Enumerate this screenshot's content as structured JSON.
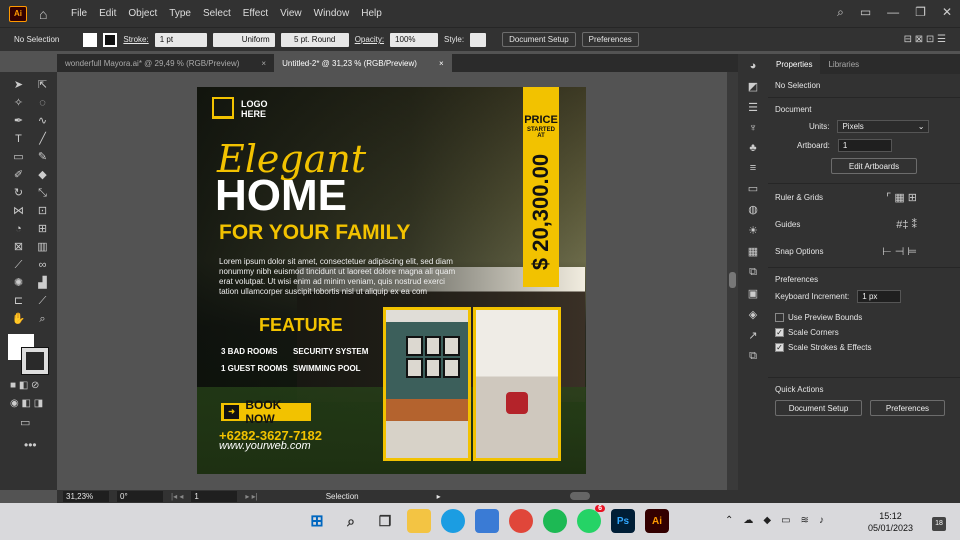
{
  "menubar": {
    "app_badge": "Ai",
    "items": [
      "File",
      "Edit",
      "Object",
      "Type",
      "Select",
      "Effect",
      "View",
      "Window",
      "Help"
    ]
  },
  "control_bar": {
    "selection": "No Selection",
    "stroke_label": "Stroke:",
    "stroke_value": "1 pt",
    "profile": "Uniform",
    "brush": "5 pt. Round",
    "opacity_label": "Opacity:",
    "opacity_value": "100%",
    "style_label": "Style:",
    "doc_setup": "Document Setup",
    "preferences": "Preferences"
  },
  "tabs": [
    {
      "label": "wonderfull Mayora.ai* @ 29,49 % (RGB/Preview)",
      "close": "×"
    },
    {
      "label": "Untitled-2* @ 31,23 % (RGB/Preview)",
      "close": "×"
    }
  ],
  "artboard": {
    "logo_text": "LOGO HERE",
    "elegant": "Elegant",
    "home": "HOME",
    "family": "FOR YOUR FAMILY",
    "lorem": "Lorem ipsum dolor sit amet, consectetuer adipiscing elit, sed diam nonummy nibh euismod tincidunt ut laoreet dolore magna ali quam erat volutpat. Ut wisi enim ad minim veniam, quis nostrud exerci tation ullamcorper suscipit lobortis nisl ut aliquip ex ea com",
    "feature_title": "FEATURE",
    "features": [
      "3 BAD ROOMS",
      "SECURITY SYSTEM",
      "1 GUEST ROOMS",
      "SWIMMING POOL"
    ],
    "book_now": "BOOK NOW",
    "phone": "+6282-3627-7182",
    "web": "www.yourweb.com",
    "price_title": "PRICE",
    "price_sub": "STARTED AT",
    "price_value": "$ 20,300.00",
    "accent": "#f2c200"
  },
  "properties": {
    "tab_properties": "Properties",
    "tab_libraries": "Libraries",
    "no_selection": "No Selection",
    "document": "Document",
    "units_label": "Units:",
    "units_value": "Pixels",
    "artboard_label": "Artboard:",
    "artboard_value": "1",
    "edit_artboards": "Edit Artboards",
    "rulers": "Ruler & Grids",
    "guides": "Guides",
    "snap": "Snap Options",
    "prefs_title": "Preferences",
    "keyboard_label": "Keyboard Increment:",
    "keyboard_value": "1 px",
    "use_preview": "Use Preview Bounds",
    "scale_corners": "Scale Corners",
    "scale_strokes": "Scale Strokes & Effects",
    "quick_actions": "Quick Actions",
    "doc_setup": "Document Setup",
    "preferences": "Preferences"
  },
  "status": {
    "zoom": "31,23%",
    "rotation": "0°",
    "artboard": "1",
    "mode": "Selection"
  },
  "taskbar": {
    "whatsapp_badge": "6",
    "time": "15:12",
    "date": "05/01/2023",
    "notif": "18"
  }
}
